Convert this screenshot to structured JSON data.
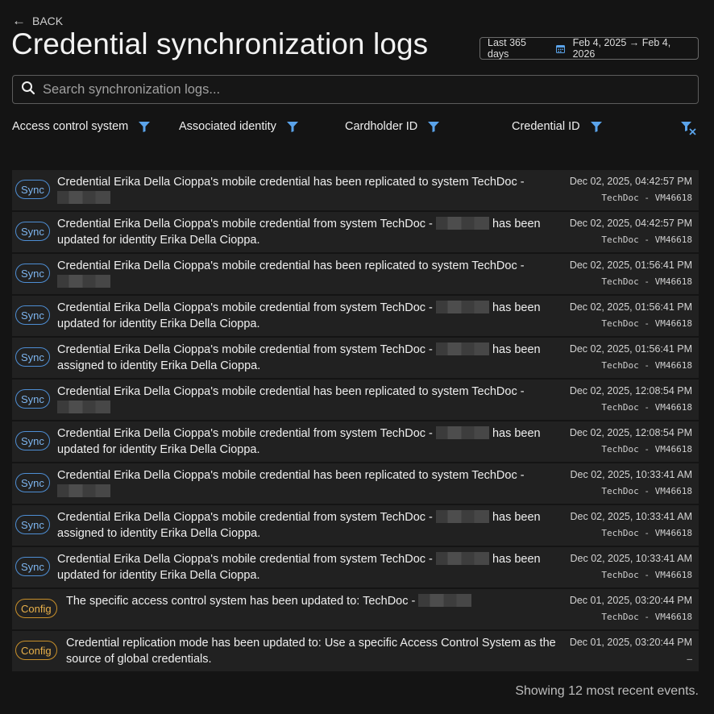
{
  "nav": {
    "back_label": "BACK"
  },
  "page": {
    "title": "Credential synchronization logs"
  },
  "date_range": {
    "preset": "Last 365 days",
    "range": "Feb 4, 2025 → Feb 4, 2026"
  },
  "search": {
    "placeholder": "Search synchronization logs..."
  },
  "filters": [
    {
      "label": "Access control system"
    },
    {
      "label": "Associated identity"
    },
    {
      "label": "Cardholder ID"
    },
    {
      "label": "Credential ID"
    }
  ],
  "logs": [
    {
      "type": "Sync",
      "text": "Credential Erika Della Cioppa's mobile credential has been replicated to system TechDoc -",
      "timestamp": "Dec 02, 2025, 04:42:57 PM",
      "source": "TechDoc - VM46618"
    },
    {
      "type": "Sync",
      "text": "Credential Erika Della Cioppa's mobile credential from system TechDoc -",
      "text_after": "has been updated for identity Erika Della Cioppa.",
      "timestamp": "Dec 02, 2025, 04:42:57 PM",
      "source": "TechDoc - VM46618"
    },
    {
      "type": "Sync",
      "text": "Credential Erika Della Cioppa's mobile credential has been replicated to system TechDoc -",
      "timestamp": "Dec 02, 2025, 01:56:41 PM",
      "source": "TechDoc - VM46618"
    },
    {
      "type": "Sync",
      "text": "Credential Erika Della Cioppa's mobile credential from system TechDoc -",
      "text_after": "has been updated for identity Erika Della Cioppa.",
      "timestamp": "Dec 02, 2025, 01:56:41 PM",
      "source": "TechDoc - VM46618"
    },
    {
      "type": "Sync",
      "text": "Credential Erika Della Cioppa's mobile credential from system TechDoc -",
      "text_after": "has been assigned to identity Erika Della Cioppa.",
      "timestamp": "Dec 02, 2025, 01:56:41 PM",
      "source": "TechDoc - VM46618"
    },
    {
      "type": "Sync",
      "text": "Credential Erika Della Cioppa's mobile credential has been replicated to system TechDoc -",
      "timestamp": "Dec 02, 2025, 12:08:54 PM",
      "source": "TechDoc - VM46618"
    },
    {
      "type": "Sync",
      "text": "Credential Erika Della Cioppa's mobile credential from system TechDoc -",
      "text_after": "has been updated for identity Erika Della Cioppa.",
      "timestamp": "Dec 02, 2025, 12:08:54 PM",
      "source": "TechDoc - VM46618"
    },
    {
      "type": "Sync",
      "text": "Credential Erika Della Cioppa's mobile credential has been replicated to system TechDoc -",
      "timestamp": "Dec 02, 2025, 10:33:41 AM",
      "source": "TechDoc - VM46618"
    },
    {
      "type": "Sync",
      "text": "Credential Erika Della Cioppa's mobile credential from system TechDoc -",
      "text_after": "has been assigned to identity Erika Della Cioppa.",
      "timestamp": "Dec 02, 2025, 10:33:41 AM",
      "source": "TechDoc - VM46618"
    },
    {
      "type": "Sync",
      "text": "Credential Erika Della Cioppa's mobile credential from system TechDoc -",
      "text_after": "has been updated for identity Erika Della Cioppa.",
      "timestamp": "Dec 02, 2025, 10:33:41 AM",
      "source": "TechDoc - VM46618"
    },
    {
      "type": "Config",
      "text": "The specific access control system has been updated to: TechDoc -",
      "timestamp": "Dec 01, 2025, 03:20:44 PM",
      "source": "TechDoc - VM46618"
    },
    {
      "type": "Config",
      "text": "Credential replication mode has been updated to: Use a specific Access Control System as the source of global credentials.",
      "no_redact": true,
      "timestamp": "Dec 01, 2025, 03:20:44 PM",
      "source": "–"
    }
  ],
  "footer": {
    "summary": "Showing 12 most recent events."
  },
  "colors": {
    "accent": "#5aa3ea",
    "sync_badge": "#4e8ed4",
    "config_badge": "#c9902a",
    "background": "#141414",
    "row": "#212121"
  },
  "icons": {
    "back": "arrow-left-icon",
    "calendar": "calendar-icon",
    "search": "search-icon",
    "filter": "filter-icon",
    "clear": "clear-filters-icon"
  }
}
